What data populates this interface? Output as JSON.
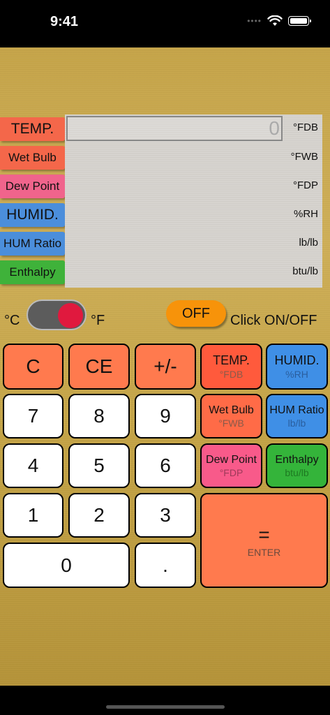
{
  "status": {
    "time": "9:41"
  },
  "labels": [
    {
      "text": "TEMP.",
      "color": "#f4674a",
      "unit": "°FDB"
    },
    {
      "text": "Wet Bulb",
      "color": "#f4674a",
      "unit": "°FWB"
    },
    {
      "text": "Dew Point",
      "color": "#f0648c",
      "unit": "°FDP"
    },
    {
      "text": "HUMID.",
      "color": "#4b8edb",
      "unit": "%RH"
    },
    {
      "text": "HUM Ratio",
      "color": "#4b8edb",
      "unit": "lb/lb"
    },
    {
      "text": "Enthalpy",
      "color": "#3fb23a",
      "unit": "btu/lb"
    }
  ],
  "display": {
    "value": "0"
  },
  "toggle": {
    "left_label": "°C",
    "right_label": "°F",
    "state": "on"
  },
  "power": {
    "button_label": "OFF",
    "hint": "Click ON/OFF"
  },
  "keys": {
    "c": "C",
    "ce": "CE",
    "sign": "+/-",
    "n7": "7",
    "n8": "8",
    "n9": "9",
    "n4": "4",
    "n5": "5",
    "n6": "6",
    "n1": "1",
    "n2": "2",
    "n3": "3",
    "n0": "0",
    "dot": ".",
    "temp": {
      "label": "TEMP.",
      "sub": "°FDB"
    },
    "humid": {
      "label": "HUMID.",
      "sub": "%RH"
    },
    "wet": {
      "label": "Wet Bulb",
      "sub": "°FWB"
    },
    "humr": {
      "label": "HUM Ratio",
      "sub": "lb/lb"
    },
    "dew": {
      "label": "Dew Point",
      "sub": "°FDP"
    },
    "enth": {
      "label": "Enthalpy",
      "sub": "btu/lb"
    },
    "enter": {
      "label": "=",
      "sub": "ENTER"
    }
  }
}
